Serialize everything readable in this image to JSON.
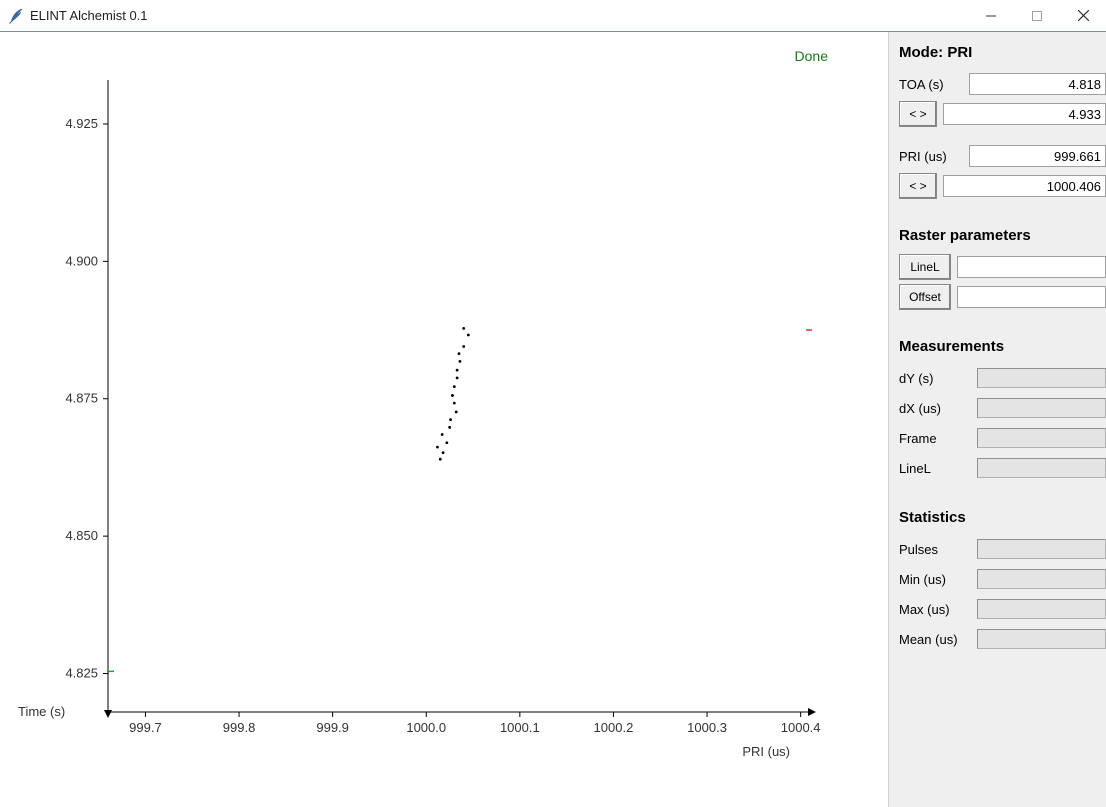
{
  "window": {
    "title": "ELINT Alchemist 0.1"
  },
  "status": "Done",
  "plot": {
    "xlabel": "PRI (us)",
    "ylabel": "Time (s)",
    "x_ticks": [
      "999.7",
      "999.8",
      "999.9",
      "1000.0",
      "1000.1",
      "1000.2",
      "1000.3",
      "1000.4"
    ],
    "y_ticks": [
      "4.825",
      "4.850",
      "4.875",
      "4.900",
      "4.925"
    ]
  },
  "chart_data": {
    "type": "scatter",
    "xlabel": "PRI (us)",
    "ylabel": "Time (s)",
    "xlim": [
      999.66,
      1000.41
    ],
    "ylim": [
      4.933,
      4.818
    ],
    "points": [
      {
        "x": 1000.015,
        "y": 4.864
      },
      {
        "x": 1000.018,
        "y": 4.8652
      },
      {
        "x": 1000.012,
        "y": 4.8662
      },
      {
        "x": 1000.022,
        "y": 4.867
      },
      {
        "x": 1000.017,
        "y": 4.8685
      },
      {
        "x": 1000.025,
        "y": 4.8698
      },
      {
        "x": 1000.026,
        "y": 4.8712
      },
      {
        "x": 1000.032,
        "y": 4.8726
      },
      {
        "x": 1000.03,
        "y": 4.8742
      },
      {
        "x": 1000.028,
        "y": 4.8756
      },
      {
        "x": 1000.03,
        "y": 4.8772
      },
      {
        "x": 1000.033,
        "y": 4.8788
      },
      {
        "x": 1000.033,
        "y": 4.8802
      },
      {
        "x": 1000.036,
        "y": 4.8818
      },
      {
        "x": 1000.035,
        "y": 4.8832
      },
      {
        "x": 1000.04,
        "y": 4.8845
      },
      {
        "x": 1000.045,
        "y": 4.8866
      },
      {
        "x": 1000.04,
        "y": 4.8878
      }
    ],
    "markers": {
      "left_y": 4.8254,
      "right_y": 4.8875
    }
  },
  "panel": {
    "mode_label": "Mode: PRI",
    "toa_label": "TOA (s)",
    "toa_min": "4.818",
    "toa_max": "4.933",
    "pri_label": "PRI (us)",
    "pri_min": "999.661",
    "pri_max": "1000.406",
    "range_btn": "< >",
    "raster_heading": "Raster parameters",
    "linel_btn": "LineL",
    "offset_btn": "Offset",
    "meas_heading": "Measurements",
    "meas_dy": "dY (s)",
    "meas_dx": "dX (us)",
    "meas_frame": "Frame",
    "meas_linel": "LineL",
    "stats_heading": "Statistics",
    "stats_pulses": "Pulses",
    "stats_min": "Min (us)",
    "stats_max": "Max (us)",
    "stats_mean": "Mean (us)"
  }
}
